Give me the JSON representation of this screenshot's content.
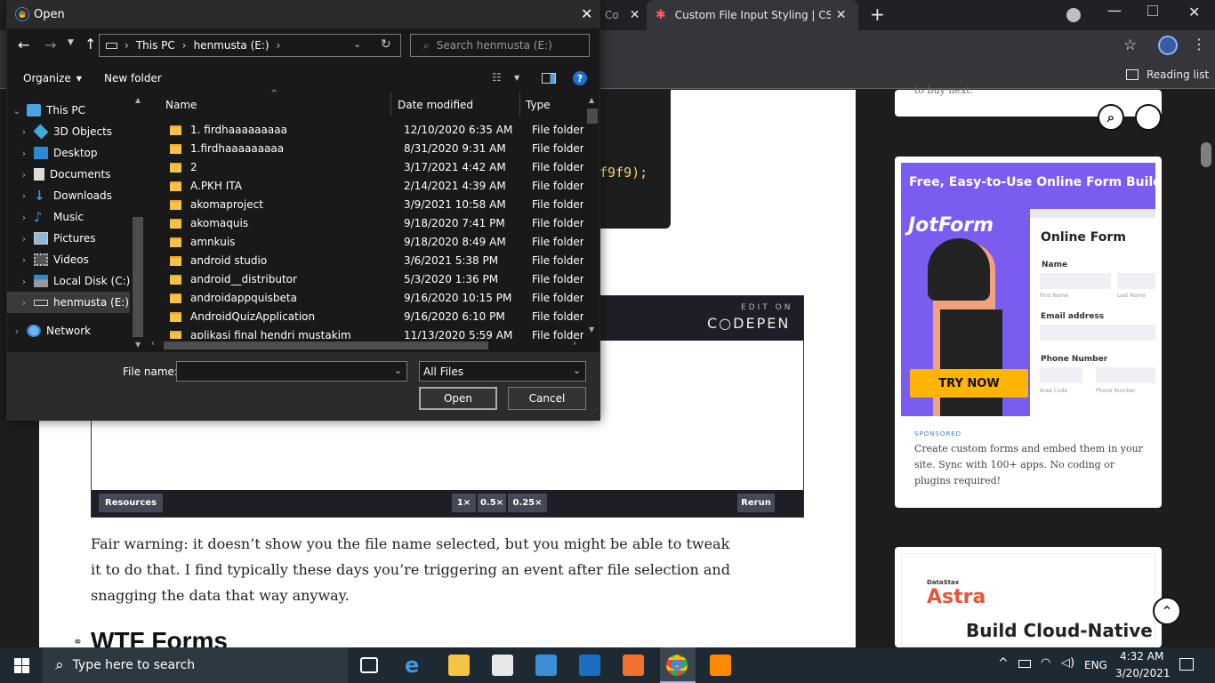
{
  "browser": {
    "tabs": [
      {
        "label": "Co"
      },
      {
        "label": "Custom File Input Styling | CSS-Tr"
      }
    ],
    "reading_list": "Reading list",
    "icons": [
      "close-icon",
      "plus-icon",
      "star-icon",
      "reading-list-icon"
    ]
  },
  "dialog": {
    "title": "Open",
    "breadcrumb": [
      "This PC",
      "henmusta (E:)"
    ],
    "search_placeholder": "Search henmusta (E:)",
    "organize_label": "Organize",
    "new_folder_label": "New folder",
    "nav_items": [
      {
        "label": "This PC"
      },
      {
        "label": "3D Objects"
      },
      {
        "label": "Desktop"
      },
      {
        "label": "Documents"
      },
      {
        "label": "Downloads"
      },
      {
        "label": "Music"
      },
      {
        "label": "Pictures"
      },
      {
        "label": "Videos"
      },
      {
        "label": "Local Disk (C:)"
      },
      {
        "label": "henmusta (E:)"
      },
      {
        "label": "Network"
      }
    ],
    "columns": {
      "name": "Name",
      "date": "Date modified",
      "type": "Type"
    },
    "files": [
      {
        "name": "1. firdhaaaaaaaaa",
        "date": "12/10/2020 6:35 AM",
        "type": "File folder"
      },
      {
        "name": "1.firdhaaaaaaaaa",
        "date": "8/31/2020 9:31 AM",
        "type": "File folder"
      },
      {
        "name": "2",
        "date": "3/17/2021 4:42 AM",
        "type": "File folder"
      },
      {
        "name": "A.PKH ITA",
        "date": "2/14/2021 4:39 AM",
        "type": "File folder"
      },
      {
        "name": "akomaproject",
        "date": "3/9/2021 10:58 AM",
        "type": "File folder"
      },
      {
        "name": "akomaquis",
        "date": "9/18/2020 7:41 PM",
        "type": "File folder"
      },
      {
        "name": "amnkuis",
        "date": "9/18/2020 8:49 AM",
        "type": "File folder"
      },
      {
        "name": "android studio",
        "date": "3/6/2021 5:38 PM",
        "type": "File folder"
      },
      {
        "name": "android__distributor",
        "date": "5/3/2020 1:36 PM",
        "type": "File folder"
      },
      {
        "name": "androidappquisbeta",
        "date": "9/16/2020 10:15 PM",
        "type": "File folder"
      },
      {
        "name": "AndroidQuizApplication",
        "date": "9/16/2020 6:10 PM",
        "type": "File folder"
      },
      {
        "name": "aplikasi final hendri mustakim",
        "date": "11/13/2020 5:59 AM",
        "type": "File folder"
      }
    ],
    "file_name_label": "File name:",
    "file_name_value": "",
    "filter_value": "All Files",
    "open_label": "Open",
    "cancel_label": "Cancel"
  },
  "article": {
    "code_fragment": "f9f9);",
    "codepen_edit_on": "EDIT ON",
    "codepen_logo": "C○DEPEN",
    "codepen_buttons": {
      "resources": "Resources",
      "x1": "1×",
      "x05": "0.5×",
      "x025": "0.25×",
      "rerun": "Rerun"
    },
    "paragraph": "Fair warning: it doesn’t show you the file name selected, but you might be able to tweak it to do that. I find typically these days you’re triggering an event after file selection and snagging the data that way anyway.",
    "heading": "WTF Forms"
  },
  "sidebar": {
    "top_card_text": "to buy next.",
    "ad1": {
      "headline": "Free, Easy-to-Use Online Form Builder",
      "brand": "JotForm",
      "form_title": "Online Form",
      "name_label": "Name",
      "first_name": "First Name",
      "last_name": "Last Name",
      "email_label": "Email address",
      "phone_label": "Phone Number",
      "area_code": "Area Code",
      "phone_small": "Phone Number",
      "cta": "TRY NOW",
      "sponsored": "SPONSORED",
      "description": "Create custom forms and embed them in your site. Sync with 100+ apps. No coding or plugins required!"
    },
    "ad2": {
      "company_small": "DataStax",
      "brand": "Astra",
      "headline": "Build Cloud-Native"
    }
  },
  "taskbar": {
    "search_placeholder": "Type here to search",
    "language": "ENG",
    "time": "4:32 AM",
    "date": "3/20/2021"
  }
}
